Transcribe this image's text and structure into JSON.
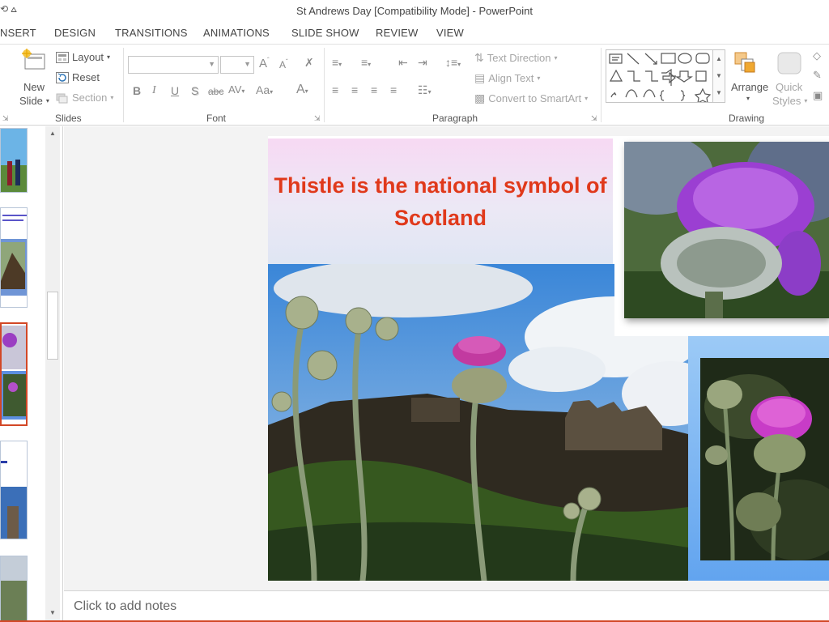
{
  "window": {
    "title": "St Andrews Day [Compatibility Mode] - PowerPoint",
    "qat_glyphs": "⟲   ⩟"
  },
  "tabs": [
    "NSERT",
    "DESIGN",
    "TRANSITIONS",
    "ANIMATIONS",
    "SLIDE SHOW",
    "REVIEW",
    "VIEW"
  ],
  "ribbon": {
    "slides": {
      "new_slide": "New",
      "new_slide2": "Slide",
      "layout": "Layout",
      "reset": "Reset",
      "section": "Section",
      "group_label": "Slides"
    },
    "font": {
      "group_label": "Font",
      "bold": "B",
      "italic": "I",
      "underline": "U",
      "shadow": "S",
      "strike": "abc",
      "spacing": "AV",
      "case": "Aa",
      "grow": "A",
      "shrink": "A",
      "color": "A"
    },
    "paragraph": {
      "group_label": "Paragraph",
      "text_direction": "Text Direction",
      "align_text": "Align Text",
      "smartart": "Convert to SmartArt"
    },
    "drawing": {
      "group_label": "Drawing",
      "arrange": "Arrange",
      "quick_styles": "Quick",
      "quick_styles2": "Styles"
    }
  },
  "slide": {
    "title": "Thistle is the national symbol of Scotland",
    "title_color": "#e0391b"
  },
  "notes": {
    "placeholder": "Click to add notes"
  },
  "colors": {
    "accent": "#d24726",
    "blue_shape": "#62a4ef"
  }
}
